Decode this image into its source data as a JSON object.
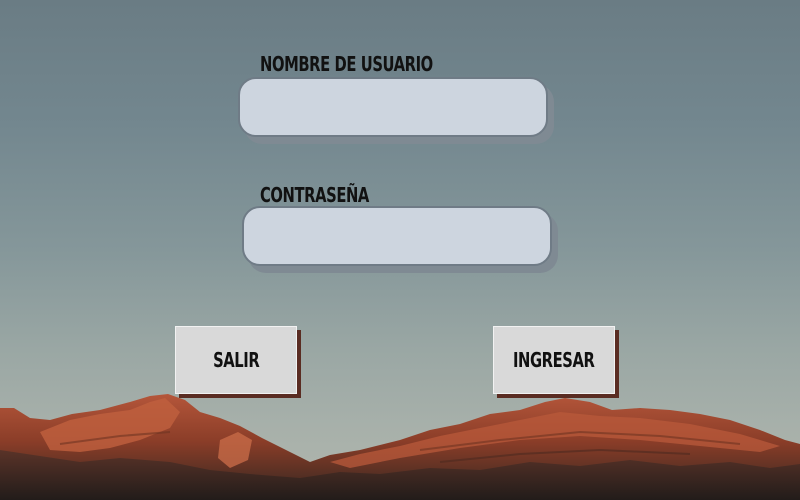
{
  "form": {
    "username_label": "NOMBRE DE USUARIO",
    "username_value": "",
    "password_label": "CONTRASEÑA",
    "password_value": ""
  },
  "buttons": {
    "exit_label": "SALIR",
    "login_label": "INGRESAR"
  },
  "colors": {
    "field_fill": "#cdd5df",
    "button_fill": "#d9d9d9",
    "button_shadow": "#5a2c22"
  }
}
